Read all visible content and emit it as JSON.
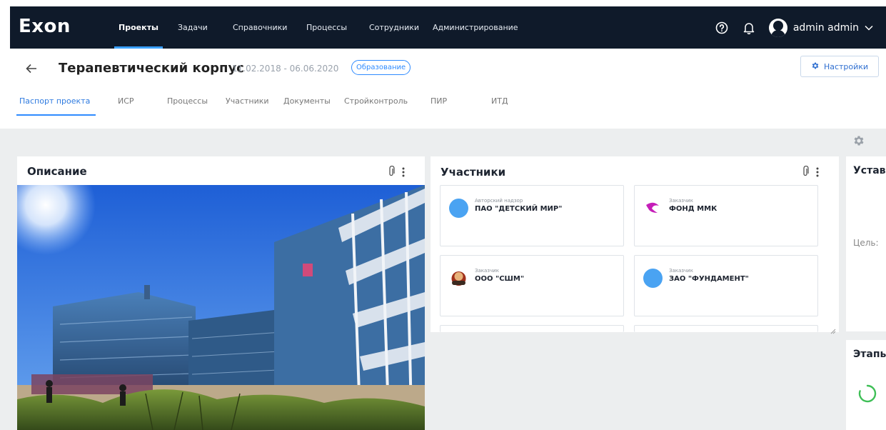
{
  "app": {
    "logo": "Exon",
    "nav": [
      "Проекты",
      "Задачи",
      "Справочники",
      "Процессы",
      "Сотрудники",
      "Администрирование"
    ],
    "user": "admin admin"
  },
  "project": {
    "title": "Терапевтический корпус",
    "dates": "11.02.2018 - 06.06.2020",
    "tag": "Образование",
    "settings_label": "Настройки",
    "tabs": [
      "Паспорт проекта",
      "ИСР",
      "Процессы",
      "Участники",
      "Документы",
      "Стройконтроль",
      "ПИР",
      "ИТД"
    ]
  },
  "description": {
    "title": "Описание"
  },
  "participants": {
    "title": "Участники",
    "items": [
      {
        "role": "Авторский надзор",
        "name": "ПАО \"ДЕТСКИЙ МИР\""
      },
      {
        "role": "Заказчик",
        "name": "ФОНД ММК"
      },
      {
        "role": "Заказчик",
        "name": "ООО \"СШМ\""
      },
      {
        "role": "Заказчик",
        "name": "ЗАО \"ФУНДАМЕНТ\""
      }
    ]
  },
  "right_panel": {
    "title": "Устав",
    "goal_label": "Цель:",
    "stages_title": "Этапы"
  },
  "colors": {
    "nav_bg": "#0f1a2a",
    "accent": "#2f8bff",
    "content_bg": "#eceeef"
  }
}
